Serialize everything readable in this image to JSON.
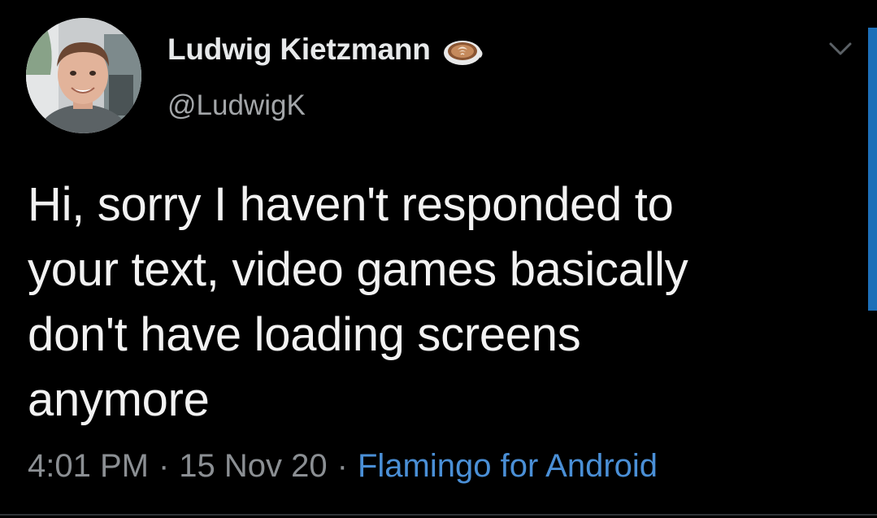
{
  "author": {
    "display_name": "Ludwig Kietzmann",
    "handle": "@LudwigK",
    "name_emoji_icon": "latte-art-coffee-icon",
    "avatar_icon": "profile-photo"
  },
  "tweet": {
    "text_lines": [
      "Hi, sorry I haven't responded to",
      "your text, video games basically",
      "don't have loading screens",
      "anymore"
    ],
    "time": "4:01 PM",
    "date": "15 Nov 20",
    "separator": "·",
    "source": "Flamingo for Android"
  },
  "menu": {
    "icon": "chevron-down-icon"
  },
  "colors": {
    "background": "#000000",
    "text": "#f2f2f2",
    "secondary_text": "#8b8f93",
    "link": "#4a8fd6",
    "accent_bar": "#1d6fb8"
  }
}
